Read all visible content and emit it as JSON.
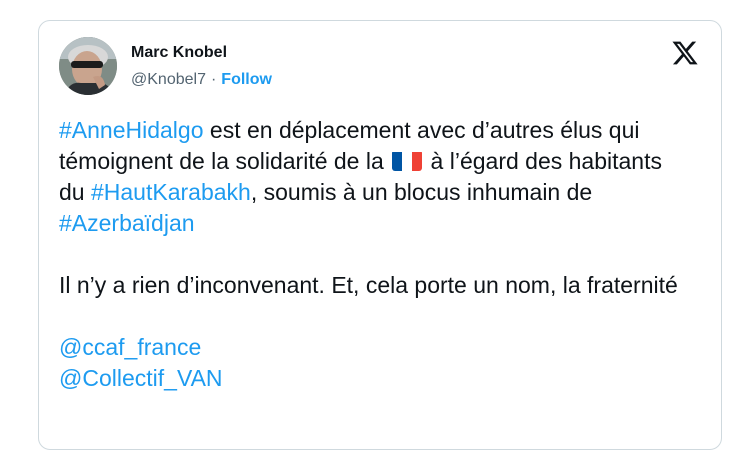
{
  "author": {
    "name": "Marc Knobel",
    "handle": "@Knobel7",
    "separator": "·",
    "follow_label": "Follow"
  },
  "brand": {
    "icon": "x-logo-icon"
  },
  "tweet": {
    "p1_tag1": "#AnneHidalgo",
    "p1_text1": " est en déplacement avec d’autres élus qui témoignent de la solidarité de la ",
    "p1_flag": "france-flag-icon",
    "p1_text2": " à l’égard des habitants du ",
    "p1_tag2": "#HautKarabakh",
    "p1_text3": ", soumis à un blocus inhumain de ",
    "p1_tag3": "#Azerbaïdjan",
    "p2_text": "Il n’y a rien d’inconvenant. Et, cela porte un nom, la fraternité",
    "mentions": [
      "@ccaf_france",
      "@Collectif_VAN"
    ]
  },
  "colors": {
    "link": "#1d9bf0",
    "text": "#0f1419",
    "muted": "#536471",
    "border": "#cfd9de",
    "flag_blue": "#0055a4",
    "flag_white": "#ffffff",
    "flag_red": "#ef4135"
  }
}
